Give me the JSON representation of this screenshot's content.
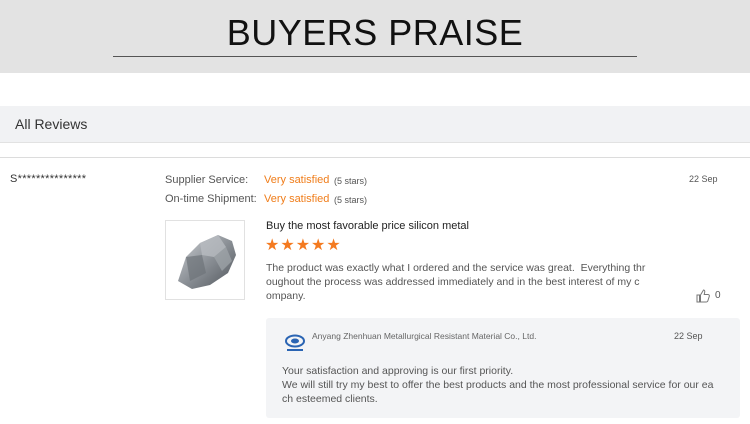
{
  "banner": {
    "title": "BUYERS PRAISE"
  },
  "section": {
    "title": "All Reviews"
  },
  "review": {
    "reviewer": "S***************",
    "supplier_service_label": "Supplier Service:",
    "supplier_service_value": "Very satisfied",
    "supplier_service_stars": "(5 stars)",
    "shipment_label": "On-time Shipment:",
    "shipment_value": "Very satisfied",
    "shipment_stars": "(5 stars)",
    "date": "22 Sep",
    "product_title": "Buy the most favorable price silicon metal",
    "rating": 5,
    "text": "The product was exactly what I ordered and the service was great.  Everything thr\noughout the process was addressed immediately and in the best interest of my c\nompany.",
    "likes": "0",
    "thumbnail": "silicon-metal-rock-image"
  },
  "reply": {
    "company": "Anyang Zhenhuan Metallurgical Resistant Material Co., Ltd.",
    "date": "22 Sep",
    "text": "Your satisfaction and approving is our first priority.\nWe will still try my best to offer the best products and the most professional service for our ea\nch esteemed clients."
  },
  "colors": {
    "accent": "#f07d1a",
    "star": "#f47a20",
    "banner_bg": "#e3e3e3"
  }
}
